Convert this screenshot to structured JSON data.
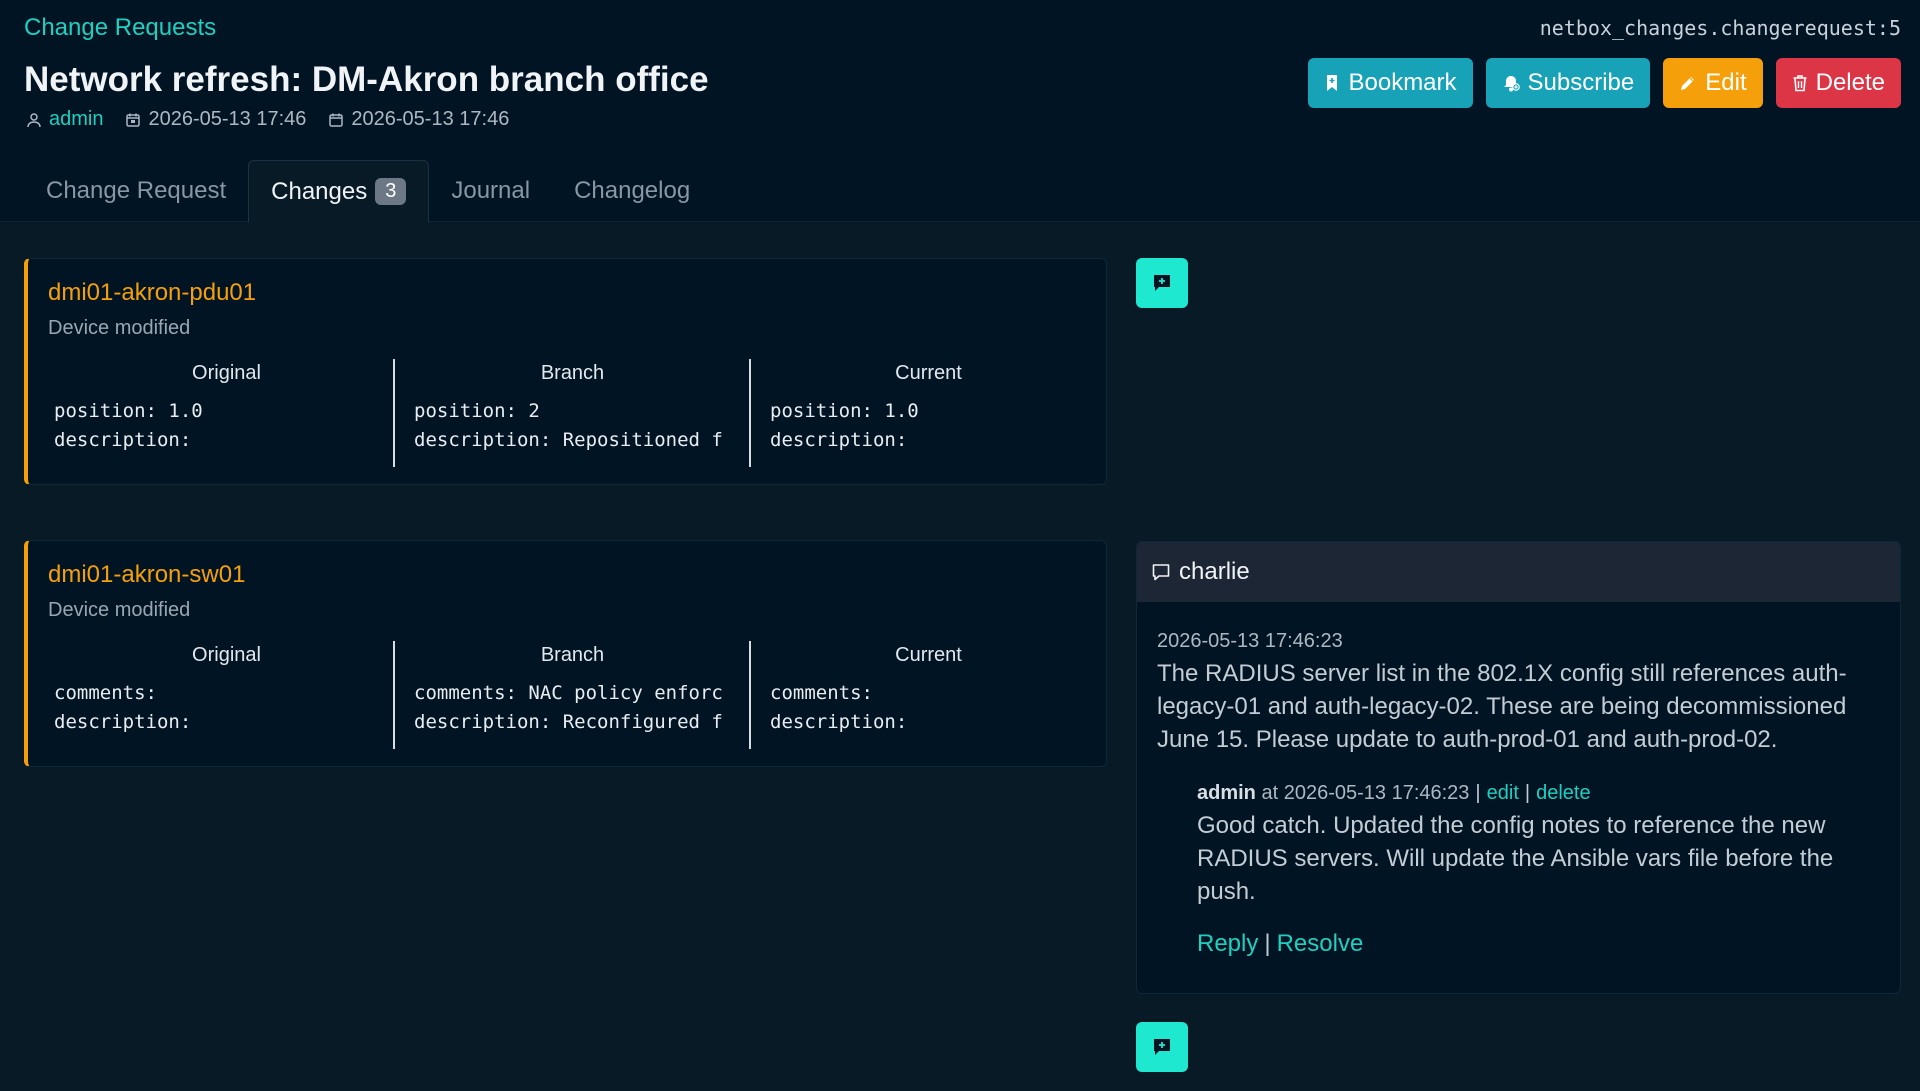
{
  "breadcrumb": "Change Requests",
  "object_id": "netbox_changes.changerequest:5",
  "title": "Network refresh: DM-Akron branch office",
  "meta": {
    "user": "admin",
    "created": "2026-05-13 17:46",
    "modified": "2026-05-13 17:46"
  },
  "actions": {
    "bookmark": "Bookmark",
    "subscribe": "Subscribe",
    "edit": "Edit",
    "delete": "Delete"
  },
  "tabs": [
    {
      "label": "Change Request"
    },
    {
      "label": "Changes",
      "count": "3"
    },
    {
      "label": "Journal"
    },
    {
      "label": "Changelog"
    }
  ],
  "colors": {
    "accent": "#1fcfc0",
    "warning": "#f5a00a",
    "danger": "#dc3545",
    "info": "#17a2b8"
  },
  "column_headers": {
    "original": "Original",
    "branch": "Branch",
    "current": "Current"
  },
  "changes": [
    {
      "object": "dmi01-akron-pdu01",
      "action": "Device modified",
      "original": "position: 1.0\ndescription:",
      "branch": "position: 2\ndescription: Repositioned f",
      "current": "position: 1.0\ndescription:"
    },
    {
      "object": "dmi01-akron-sw01",
      "action": "Device modified",
      "original": "comments:\ndescription:",
      "branch": "comments: NAC policy enforc\ndescription: Reconfigured f",
      "current": "comments:\ndescription:"
    }
  ],
  "thread": {
    "author": "charlie",
    "timestamp": "2026-05-13 17:46:23",
    "text": "The RADIUS server list in the 802.1X config still references auth-legacy-01 and auth-legacy-02. These are being decommissioned June 15. Please update to auth-prod-01 and auth-prod-02.",
    "reply": {
      "author": "admin",
      "at_text": "at 2026-05-13 17:46:23",
      "edit": "edit",
      "delete": "delete",
      "text": "Good catch. Updated the config notes to reference the new RADIUS servers. Will update the Ansible vars file before the push."
    },
    "reply_label": "Reply",
    "resolve_label": "Resolve"
  },
  "icons": [
    "user-icon",
    "calendar-icon",
    "calendar-edit-icon",
    "bookmark-icon",
    "bell-plus-icon",
    "pencil-icon",
    "trash-icon",
    "comment-add-icon",
    "comment-icon"
  ]
}
